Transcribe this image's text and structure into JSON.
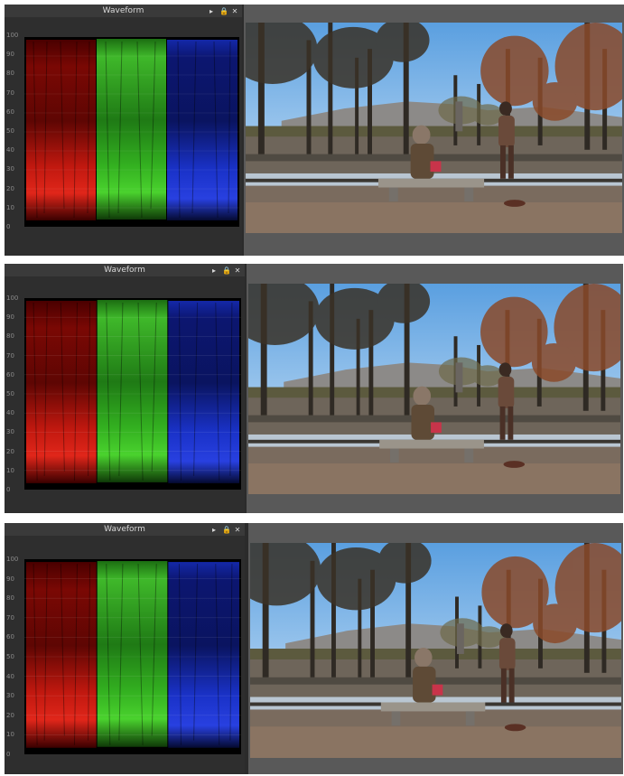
{
  "panels": [
    {
      "waveform_title": "Waveform",
      "controls": {
        "play": "▸",
        "lock": "🔒",
        "close": "✕"
      },
      "scale_labels": [
        "100",
        "90",
        "80",
        "70",
        "60",
        "50",
        "40",
        "30",
        "20",
        "10",
        "0"
      ]
    },
    {
      "waveform_title": "Waveform",
      "controls": {
        "play": "▸",
        "lock": "🔒",
        "close": "✕"
      },
      "scale_labels": [
        "100",
        "90",
        "80",
        "70",
        "60",
        "50",
        "40",
        "30",
        "20",
        "10",
        "0"
      ]
    },
    {
      "waveform_title": "Waveform",
      "controls": {
        "play": "▸",
        "lock": "🔒",
        "close": "✕"
      },
      "scale_labels": [
        "100",
        "90",
        "80",
        "70",
        "60",
        "50",
        "40",
        "30",
        "20",
        "10",
        "0"
      ]
    }
  ],
  "colors": {
    "red_channel": "#c41a12",
    "green_channel": "#2fb51c",
    "blue_channel": "#1a30c8",
    "panel_bg": "#2b2b2b",
    "viewer_bg": "#595959",
    "sky": "#9cc8ec"
  }
}
